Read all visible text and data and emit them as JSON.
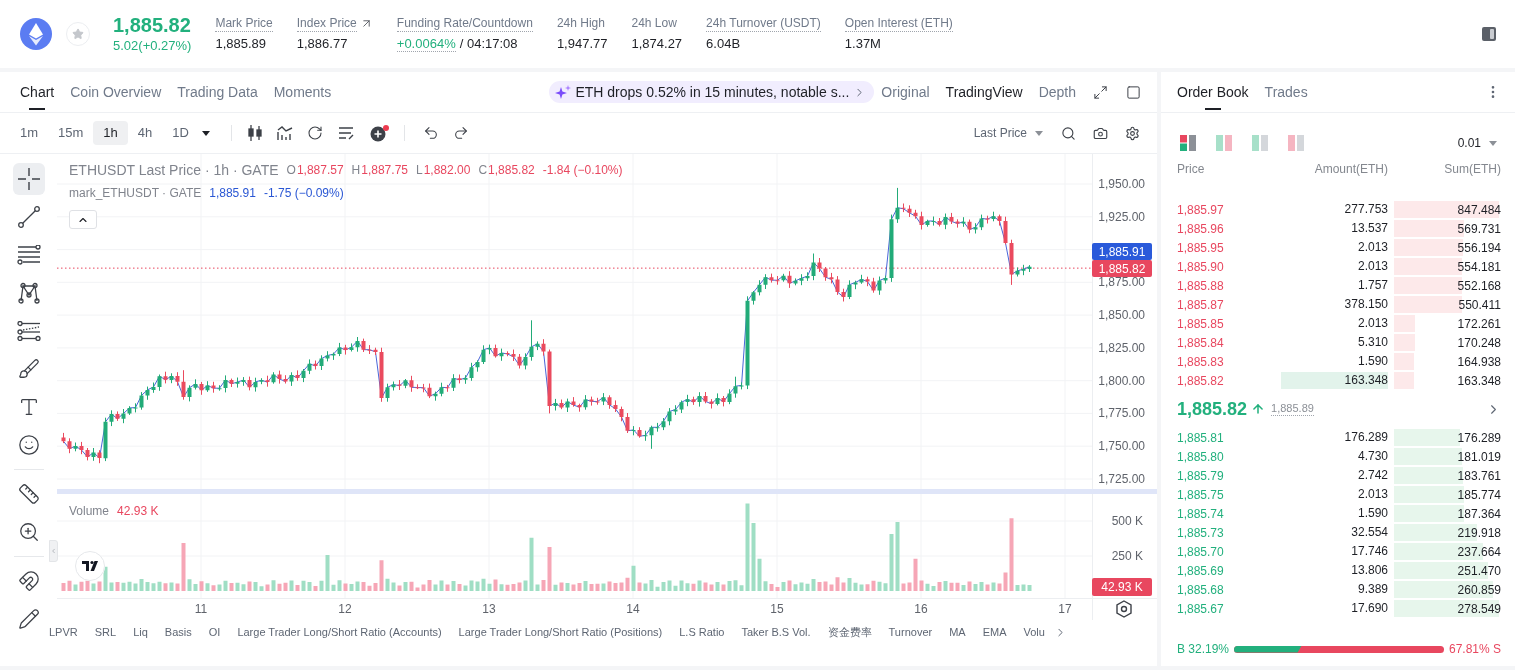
{
  "header": {
    "price": "1,885.82",
    "change": "5.02(+0.27%)",
    "stats": [
      {
        "kind": "tooltip",
        "label": "Mark Price",
        "value": "1,885.89"
      },
      {
        "kind": "link",
        "label": "Index Price",
        "value": "1,886.77"
      },
      {
        "kind": "funding",
        "label": "Funding Rate/Countdown",
        "rate": "+0.0064%",
        "value": "/ 04:17:08"
      },
      {
        "kind": "plain",
        "label": "24h High",
        "value": "1,947.77"
      },
      {
        "kind": "plain",
        "label": "24h Low",
        "value": "1,874.27"
      },
      {
        "kind": "tooltip",
        "label": "24h Turnover (USDT)",
        "value": "6.04B"
      },
      {
        "kind": "tooltip",
        "label": "Open Interest (ETH)",
        "value": "1.37M"
      }
    ]
  },
  "chart_panel": {
    "tabs": [
      {
        "label": "Chart",
        "selected": true
      },
      {
        "label": "Coin Overview",
        "selected": false
      },
      {
        "label": "Trading Data",
        "selected": false
      },
      {
        "label": "Moments",
        "selected": false
      }
    ],
    "ai_banner": "ETH drops 0.52% in 15 minutes, notable s...",
    "views": [
      {
        "label": "Original",
        "selected": false
      },
      {
        "label": "TradingView",
        "selected": true
      },
      {
        "label": "Depth",
        "selected": false
      }
    ],
    "intervals": [
      {
        "label": "1m",
        "selected": false
      },
      {
        "label": "15m",
        "selected": false
      },
      {
        "label": "1h",
        "selected": true
      },
      {
        "label": "4h",
        "selected": false
      },
      {
        "label": "1D",
        "selected": false
      }
    ],
    "price_source": "Last Price",
    "tool_groups": [
      [
        {
          "kind": "crosshair",
          "selected": true
        },
        {
          "kind": "line",
          "selected": false
        },
        {
          "kind": "fib",
          "selected": false
        },
        {
          "kind": "pattern",
          "selected": false
        },
        {
          "kind": "channel",
          "selected": false
        },
        {
          "kind": "brush",
          "selected": false
        },
        {
          "kind": "text",
          "selected": false
        },
        {
          "kind": "emoji",
          "selected": false
        }
      ],
      [
        {
          "kind": "ruler",
          "selected": false
        },
        {
          "kind": "zoom",
          "selected": false
        }
      ],
      [
        {
          "kind": "magnet",
          "selected": false
        },
        {
          "kind": "pencil",
          "selected": false
        }
      ]
    ],
    "legend": {
      "title": "ETHUSDT Last Price · 1h · GATE",
      "ohlc": [
        {
          "label": "O",
          "value": "1,887.57"
        },
        {
          "label": "H",
          "value": "1,887.75"
        },
        {
          "label": "L",
          "value": "1,882.00"
        },
        {
          "label": "C",
          "value": "1,885.82"
        }
      ],
      "change": "-1.84 (−0.10%)"
    },
    "mark_legend": {
      "title": "mark_ETHUSDT · GATE",
      "value": "1,885.91",
      "change": "-1.75 (−0.09%)"
    },
    "price_axis": [
      "1,950.00",
      "1,925.00",
      "1,875.00",
      "1,850.00",
      "1,825.00",
      "1,800.00",
      "1,775.00",
      "1,750.00",
      "1,725.00"
    ],
    "price_badges": [
      {
        "kind": "mark",
        "value": "1,885.91"
      },
      {
        "kind": "last",
        "value": "1,885.82"
      }
    ],
    "volume_legend": {
      "label": "Volume",
      "value": "42.93 K"
    },
    "volume_axis": [
      "500 K",
      "250 K"
    ],
    "volume_badge": "42.93 K",
    "time_axis": [
      "11",
      "12",
      "13",
      "14",
      "15",
      "16",
      "17"
    ],
    "indicators": [
      "LPVR",
      "SRL",
      "Liq",
      "Basis",
      "OI",
      "Large Trader Long/Short Ratio (Accounts)",
      "Large Trader Long/Short Ratio (Positions)",
      "L.S Ratio",
      "Taker B.S Vol.",
      "资金费率",
      "Turnover",
      "MA",
      "EMA",
      "Volu"
    ]
  },
  "order_book": {
    "tabs": [
      {
        "label": "Order Book",
        "selected": true
      },
      {
        "label": "Trades",
        "selected": false
      }
    ],
    "layouts": [
      {
        "kind": "stacked",
        "selected": true
      },
      {
        "kind": "side",
        "selected": false
      },
      {
        "kind": "bids",
        "selected": false
      },
      {
        "kind": "asks",
        "selected": false
      }
    ],
    "precision": "0.01",
    "columns": [
      "Price",
      "Amount(ETH)",
      "Sum(ETH)"
    ],
    "asks": [
      {
        "price": "1,885.97",
        "amount": "277.753",
        "sum": "847.484",
        "level": 1,
        "highlighted": false
      },
      {
        "price": "1,885.96",
        "amount": "13.537",
        "sum": "569.731",
        "level": 0.67,
        "highlighted": false
      },
      {
        "price": "1,885.95",
        "amount": "2.013",
        "sum": "556.194",
        "level": 0.66,
        "highlighted": false
      },
      {
        "price": "1,885.90",
        "amount": "2.013",
        "sum": "554.181",
        "level": 0.65,
        "highlighted": false
      },
      {
        "price": "1,885.88",
        "amount": "1.757",
        "sum": "552.168",
        "level": 0.65,
        "highlighted": false
      },
      {
        "price": "1,885.87",
        "amount": "378.150",
        "sum": "550.411",
        "level": 0.65,
        "highlighted": false
      },
      {
        "price": "1,885.85",
        "amount": "2.013",
        "sum": "172.261",
        "level": 0.2,
        "highlighted": false
      },
      {
        "price": "1,885.84",
        "amount": "5.310",
        "sum": "170.248",
        "level": 0.2,
        "highlighted": false
      },
      {
        "price": "1,885.83",
        "amount": "1.590",
        "sum": "164.938",
        "level": 0.19,
        "highlighted": false
      },
      {
        "price": "1,885.82",
        "amount": "163.348",
        "sum": "163.348",
        "level": 0.19,
        "highlighted": true
      }
    ],
    "last_price": "1,885.82",
    "mark_price": "1,885.89",
    "bids": [
      {
        "price": "1,885.81",
        "amount": "176.289",
        "sum": "176.289",
        "level": 0.63,
        "highlighted": false
      },
      {
        "price": "1,885.80",
        "amount": "4.730",
        "sum": "181.019",
        "level": 0.65,
        "highlighted": false
      },
      {
        "price": "1,885.79",
        "amount": "2.742",
        "sum": "183.761",
        "level": 0.66,
        "highlighted": false
      },
      {
        "price": "1,885.75",
        "amount": "2.013",
        "sum": "185.774",
        "level": 0.67,
        "highlighted": false
      },
      {
        "price": "1,885.74",
        "amount": "1.590",
        "sum": "187.364",
        "level": 0.67,
        "highlighted": false
      },
      {
        "price": "1,885.73",
        "amount": "32.554",
        "sum": "219.918",
        "level": 0.79,
        "highlighted": false
      },
      {
        "price": "1,885.70",
        "amount": "17.746",
        "sum": "237.664",
        "level": 0.85,
        "highlighted": false
      },
      {
        "price": "1,885.69",
        "amount": "13.806",
        "sum": "251.470",
        "level": 0.9,
        "highlighted": false
      },
      {
        "price": "1,885.68",
        "amount": "9.389",
        "sum": "260.859",
        "level": 0.94,
        "highlighted": false
      },
      {
        "price": "1,885.67",
        "amount": "17.690",
        "sum": "278.549",
        "level": 1,
        "highlighted": false
      }
    ],
    "ratio": {
      "buy_label": "B 32.19%",
      "sell_label": "67.81% S",
      "level": 0.3219
    }
  }
}
